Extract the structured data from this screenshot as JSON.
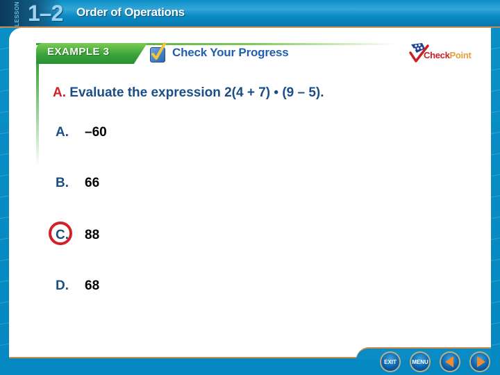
{
  "header": {
    "lesson_label": "LESSON",
    "lesson_number": "1–2",
    "lesson_title": "Order of Operations"
  },
  "banner": {
    "example_label": "EXAMPLE 3",
    "check_icon": "checkbox-check-icon",
    "section_label": "Check Your Progress"
  },
  "logo": {
    "part1": "Check",
    "part2": "Point",
    "icon": "checkpoint-logo-icon"
  },
  "question": {
    "letter": "A.",
    "text": "Evaluate the expression 2(4 + 7) • (9 – 5)."
  },
  "answers": [
    {
      "letter": "A.",
      "value": "–60",
      "correct": false
    },
    {
      "letter": "B.",
      "value": "66",
      "correct": false
    },
    {
      "letter": "C.",
      "value": "88",
      "correct": true
    },
    {
      "letter": "D.",
      "value": "68",
      "correct": false
    }
  ],
  "colors": {
    "frame_blue": "#0a8cc4",
    "title_navy": "#1a4e86",
    "accent_red": "#d1202a",
    "banner_green": "#3aa43a",
    "nav_orange": "#f08a2c"
  },
  "nav": {
    "exit_label": "EXIT",
    "menu_label": "MENU",
    "prev_icon": "triangle-left-icon",
    "next_icon": "triangle-right-icon"
  }
}
